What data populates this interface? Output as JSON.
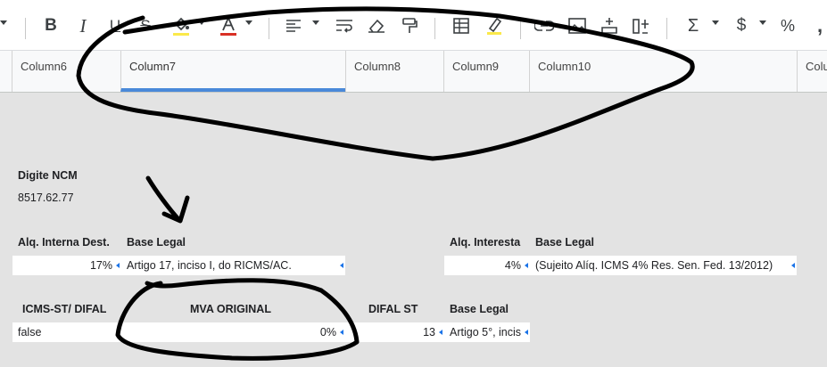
{
  "columns": [
    "Column6",
    "Column7",
    "Column8",
    "Column9",
    "Column10",
    "Colu"
  ],
  "ncm": {
    "label": "Digite NCM",
    "value": "8517.62.77"
  },
  "row1": {
    "aliq_interna_label": "Alq. Interna Dest.",
    "aliq_interna_value": "17%",
    "base_legal_label": "Base Legal",
    "base_legal_value": "Artigo 17, inciso I, do RICMS/AC.",
    "aliq_interesta_label": "Alq. Interesta",
    "aliq_interesta_value": "4%",
    "base_legal2_label": "Base Legal",
    "base_legal2_value": "(Sujeito Alíq. ICMS 4% Res. Sen. Fed. 13/2012)"
  },
  "row2": {
    "icms_label": "ICMS-ST/ DIFAL",
    "icms_value": "false",
    "mva_label": "MVA ORIGINAL",
    "mva_value": "0%",
    "difal_label": "DIFAL ST",
    "difal_value": "13",
    "base_legal_label": "Base Legal",
    "base_legal_value": "Artigo 5°, incis"
  },
  "colors": {
    "accent": "#4a89d9",
    "underline_red": "#d93025",
    "highlight_yellow": "#fbe94a",
    "ink": "#000000"
  }
}
